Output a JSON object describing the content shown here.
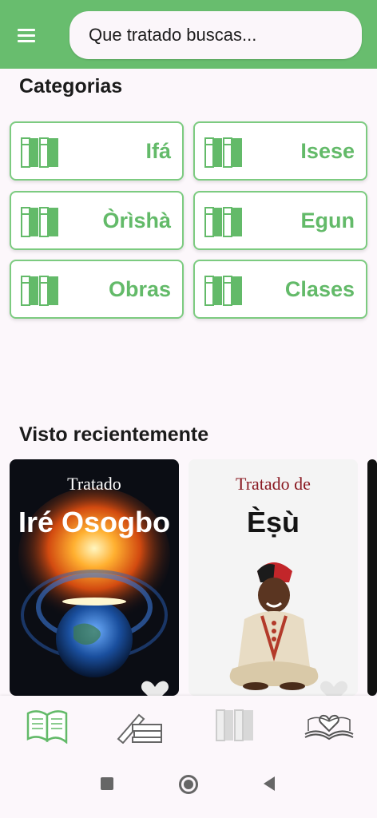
{
  "search": {
    "placeholder": "Que tratado buscas..."
  },
  "sections": {
    "categories_title": "Categorias",
    "recent_title": "Visto recientemente"
  },
  "categories": [
    {
      "label": "Ifá"
    },
    {
      "label": "Isese"
    },
    {
      "label": "Òrìshà"
    },
    {
      "label": "Egun"
    },
    {
      "label": "Obras"
    },
    {
      "label": "Clases"
    }
  ],
  "recent": [
    {
      "small": "Tratado",
      "big": "Iré Osogbo"
    },
    {
      "small": "Tratado de",
      "big": "Èṣù"
    }
  ],
  "colors": {
    "primary": "#68bd6e",
    "accent_text": "#63ba69",
    "border": "#7ccb80",
    "background": "#fcf7fb"
  },
  "icons": {
    "menu": "hamburger-menu-icon",
    "category": "books-icon",
    "nav": [
      "open-book-icon",
      "pencil-books-icon",
      "bookshelf-icon",
      "heart-book-icon"
    ],
    "system": [
      "square-recent-icon",
      "circle-home-icon",
      "triangle-back-icon"
    ]
  }
}
